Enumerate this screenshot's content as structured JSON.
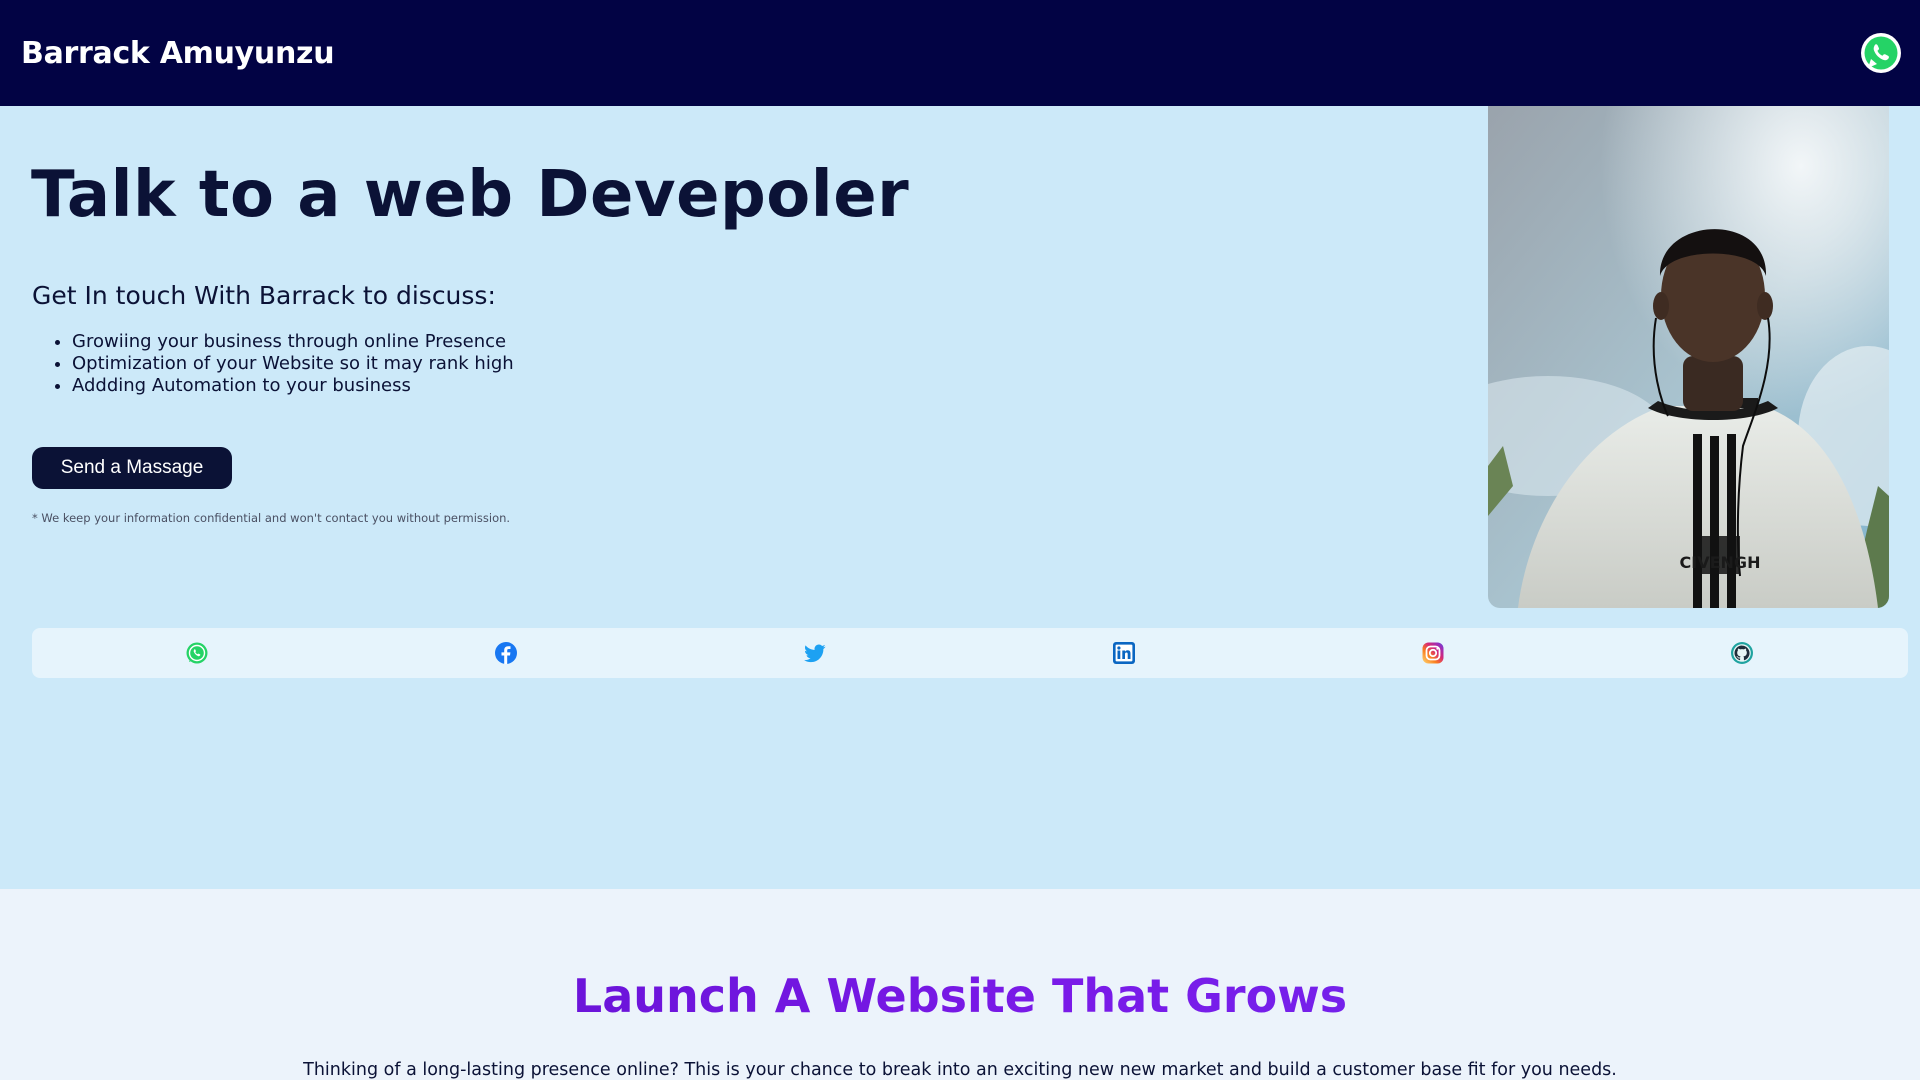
{
  "header": {
    "brand": "Barrack Amuyunzu",
    "whatsapp_icon": "whatsapp-icon"
  },
  "hero": {
    "title": "Talk to a web Devepoler",
    "subtitle": "Get In touch With Barrack to discuss:",
    "points": [
      "Growiing your business through online Presence",
      "Optimization of your Website so it may rank high",
      "Addding Automation to your business"
    ],
    "cta_label": "Send a Massage",
    "disclaimer": "* We keep your information confidential and won't contact you without permission.",
    "photo_text": "CIVENGH"
  },
  "social": [
    {
      "name": "whatsapp-icon",
      "color": "#25d366"
    },
    {
      "name": "facebook-icon",
      "color": "#1877f2"
    },
    {
      "name": "twitter-icon",
      "color": "#1da1f2"
    },
    {
      "name": "linkedin-icon",
      "color": "#0a66c2"
    },
    {
      "name": "instagram-icon",
      "color": "#e1306c"
    },
    {
      "name": "github-icon",
      "color": "#1fa3a0"
    }
  ],
  "section": {
    "title": "Launch A Website That Grows",
    "text": "Thinking of a long-lasting presence online? This is your chance to break into an exciting new new market and build a customer base fit for you needs."
  },
  "colors": {
    "navbar": "#020344",
    "hero_bg": "#cce9f9",
    "social_bar": "#e6f4fc",
    "section_bg": "#ecf3fb",
    "button": "#0b1236",
    "heading_gradient": [
      "#5a0cc8",
      "#6b2ff0"
    ]
  }
}
